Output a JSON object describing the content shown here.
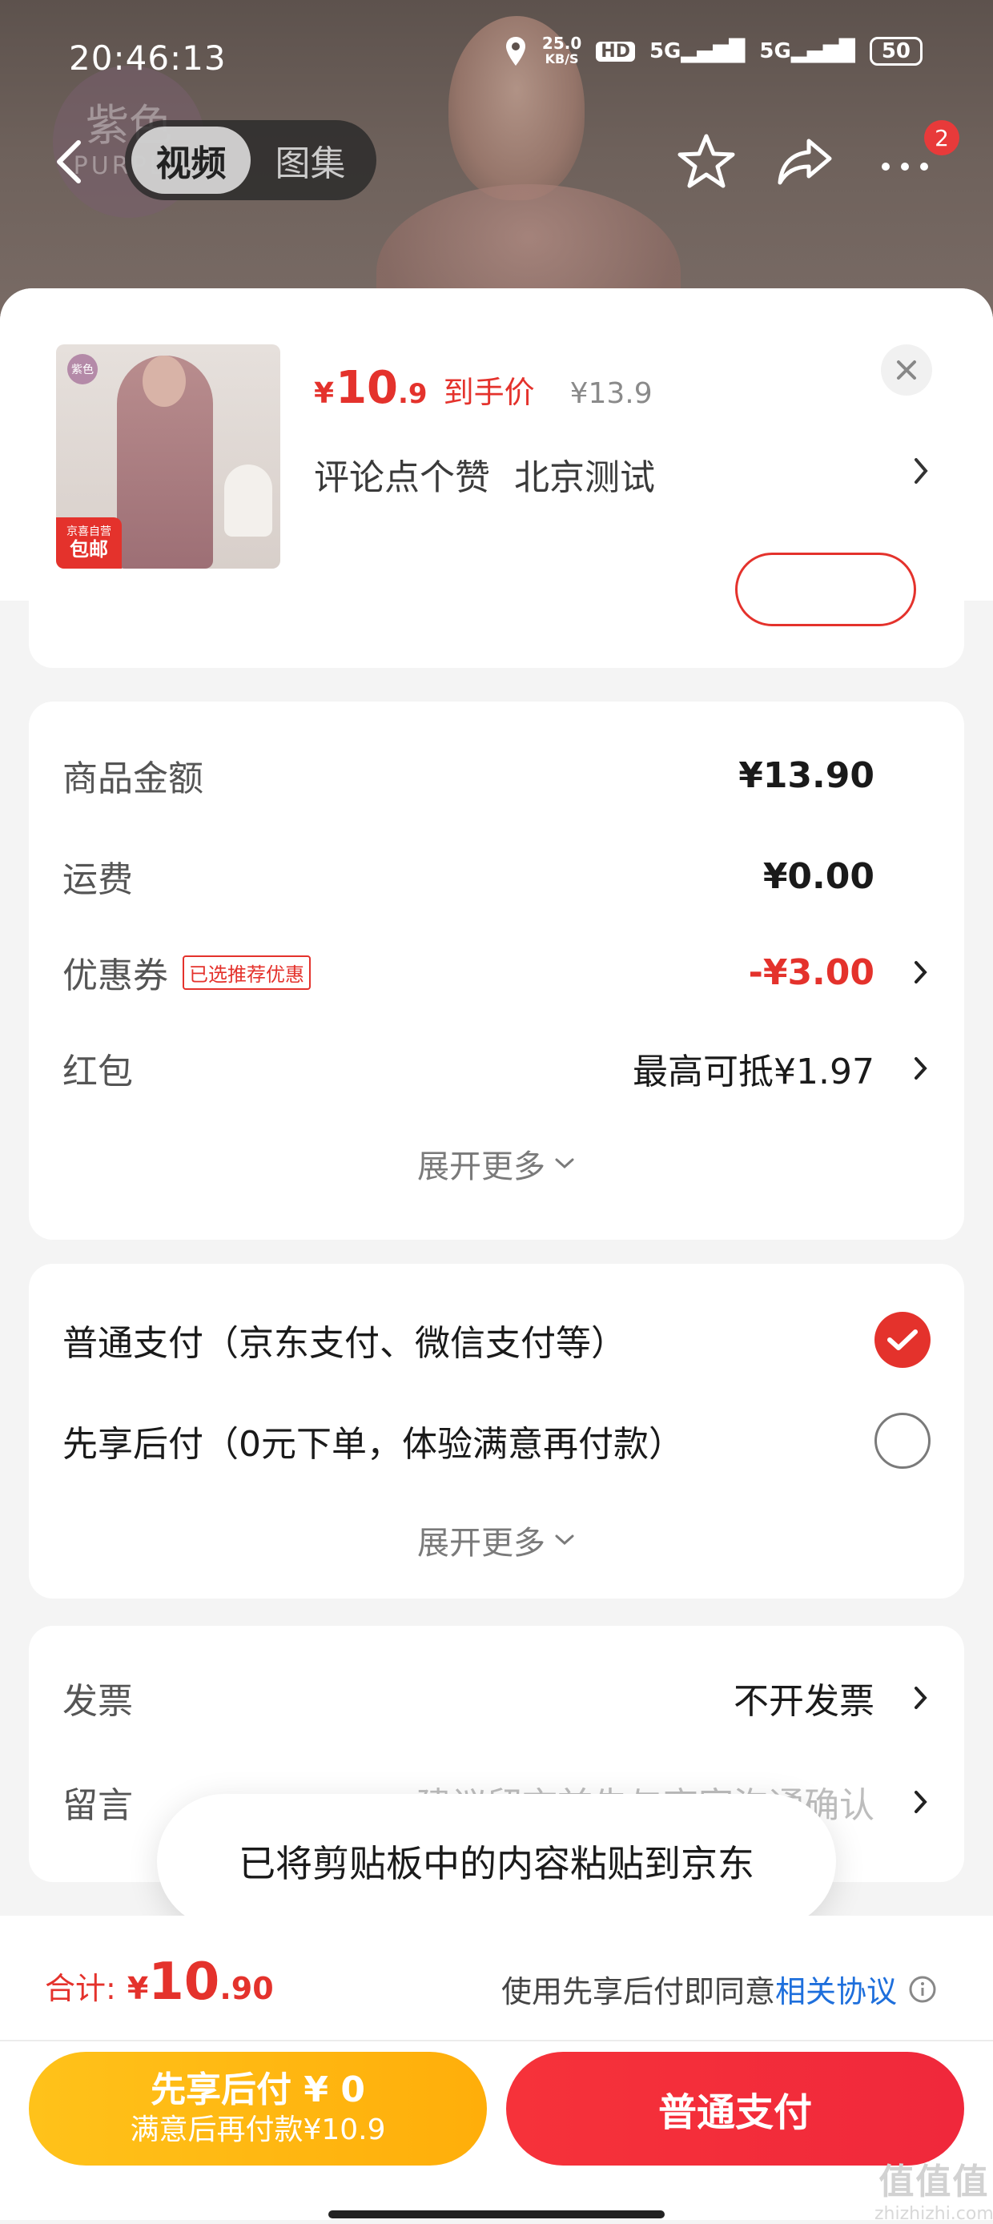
{
  "status_bar": {
    "time": "20:46:13",
    "net_speed_value": "25.0",
    "net_speed_unit": "KB/S",
    "hd": "HD",
    "sig1": "5G",
    "sig2": "5G",
    "battery": "50"
  },
  "top_nav": {
    "brand_text_1": "紫色",
    "brand_text_2": "PURPLE",
    "tabs": [
      {
        "label": "视频",
        "active": true
      },
      {
        "label": "图集",
        "active": false
      }
    ],
    "badge_count": "2"
  },
  "product": {
    "thumb_brand_label": "紫色",
    "thumb_tag_1": "京喜自营",
    "thumb_tag_2": "包邮",
    "currency": "¥",
    "price_int": "10",
    "price_dec": ".9",
    "price_label": "到手价",
    "original_price": "¥13.9",
    "spec_1": "评论点个赞",
    "spec_2": "北京测试"
  },
  "summary": {
    "rows": [
      {
        "label": "商品金额",
        "value": "¥13.90"
      },
      {
        "label": "运费",
        "value": "¥0.00"
      },
      {
        "label": "优惠券",
        "tag": "已选推荐优惠",
        "value": "-¥3.00"
      },
      {
        "label": "红包",
        "value": "最高可抵¥1.97"
      }
    ],
    "expand_label": "展开更多"
  },
  "payment": {
    "options": [
      {
        "label": "普通支付（京东支付、微信支付等）",
        "selected": true
      },
      {
        "label": "先享后付（0元下单，体验满意再付款）",
        "selected": false
      }
    ],
    "expand_label": "展开更多"
  },
  "extras": {
    "invoice_label": "发票",
    "invoice_value": "不开发票",
    "note_label": "留言",
    "note_placeholder": "建议留言前先与商家沟通确认"
  },
  "toast": "已将剪贴板中的内容粘贴到京东",
  "footer": {
    "total_label": "合计:",
    "currency": "¥",
    "total_int": "10",
    "total_dec": ".90",
    "agree_text": "使用先享后付即同意",
    "agree_link": "相关协议",
    "later_btn_1": "先享后付 ¥ 0",
    "later_btn_2": "满意后再付款¥10.9",
    "pay_btn": "普通支付"
  },
  "watermark": {
    "line1": "值值值",
    "line2": "zhizhizhi.com"
  },
  "colors": {
    "accent_red": "#e4322c",
    "link_blue": "#1e6fdc",
    "later_yellow": "#ffb80f"
  }
}
